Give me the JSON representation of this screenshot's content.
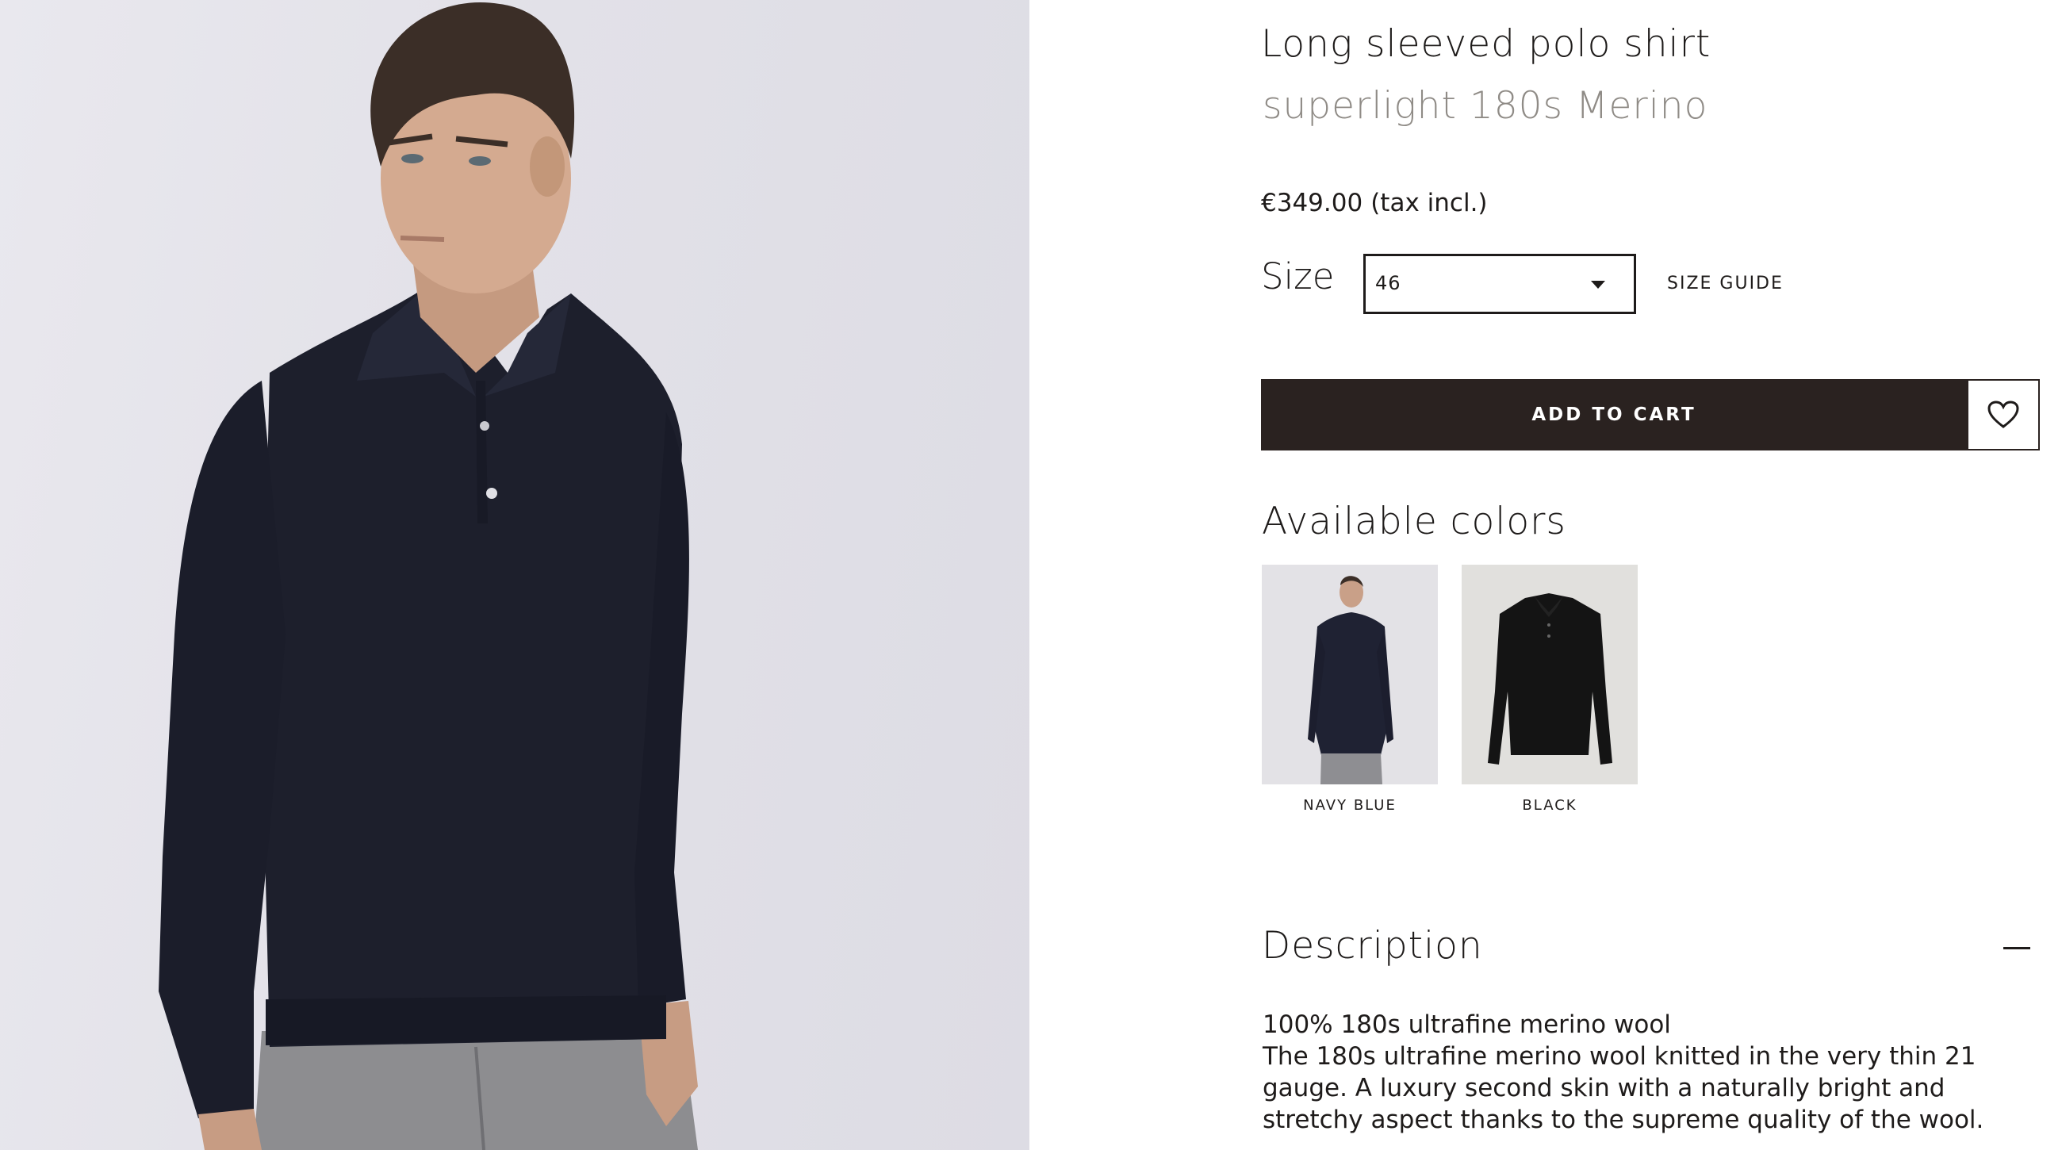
{
  "product": {
    "title": "Long sleeved polo shirt",
    "subtitle": "superlight 180s Merino",
    "price": "€349.00",
    "tax_note": "(tax incl.)"
  },
  "size": {
    "label": "Size",
    "selected": "46",
    "guide_label": "SIZE GUIDE"
  },
  "actions": {
    "add_to_cart": "ADD TO CART",
    "wishlist_icon": "heart-icon"
  },
  "colors": {
    "heading": "Available colors",
    "options": [
      {
        "label": "NAVY BLUE",
        "hex": "#1f2233"
      },
      {
        "label": "BLACK",
        "hex": "#141414"
      }
    ]
  },
  "description": {
    "heading": "Description",
    "toggle_icon": "minus-icon",
    "lines": [
      "100% 180s ultrafine merino wool",
      "The 180s ultrafine merino wool knitted in the very thin 21 gauge. A luxury second skin with a naturally bright and stretchy aspect thanks to the supreme quality of the wool."
    ]
  },
  "theme": {
    "primary_button": "#2a2220",
    "muted_text": "#8f8b86",
    "text": "#1e1b1a"
  }
}
